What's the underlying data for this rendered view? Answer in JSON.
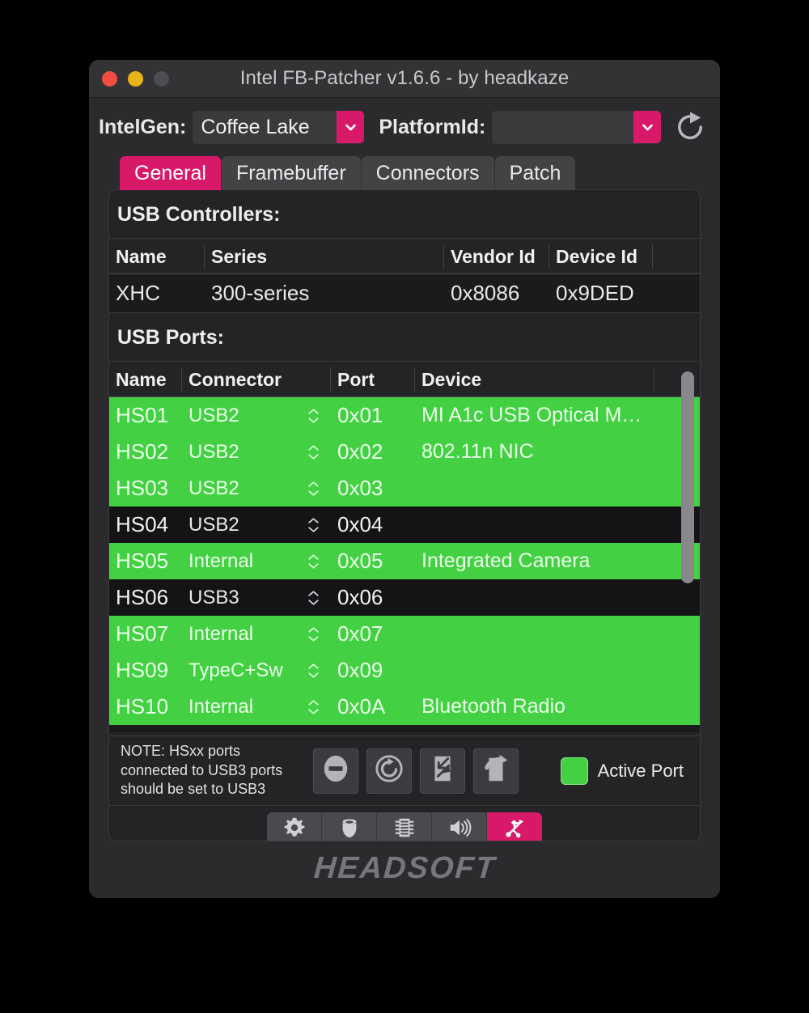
{
  "window": {
    "title": "Intel FB-Patcher v1.6.6 - by headkaze",
    "traffic_lights": [
      "close",
      "minimize",
      "zoom"
    ]
  },
  "toolbar": {
    "intelgen_label": "IntelGen:",
    "intelgen_value": "Coffee Lake",
    "platformid_label": "PlatformId:",
    "platformid_value": "",
    "refresh_icon": "refresh-icon"
  },
  "tabs": [
    {
      "label": "General",
      "active": true
    },
    {
      "label": "Framebuffer",
      "active": false
    },
    {
      "label": "Connectors",
      "active": false
    },
    {
      "label": "Patch",
      "active": false
    }
  ],
  "controllers": {
    "heading": "USB Controllers:",
    "columns": [
      "Name",
      "Series",
      "Vendor Id",
      "Device Id"
    ],
    "rows": [
      {
        "name": "XHC",
        "series": "300-series",
        "vendor_id": "0x8086",
        "device_id": "0x9DED"
      }
    ]
  },
  "ports": {
    "heading": "USB Ports:",
    "columns": [
      "Name",
      "Connector",
      "Port",
      "Device"
    ],
    "rows": [
      {
        "name": "HS01",
        "connector": "USB2",
        "port": "0x01",
        "device": "MI A1c USB Optical M…",
        "active": true
      },
      {
        "name": "HS02",
        "connector": "USB2",
        "port": "0x02",
        "device": "802.11n NIC",
        "active": true
      },
      {
        "name": "HS03",
        "connector": "USB2",
        "port": "0x03",
        "device": "",
        "active": true
      },
      {
        "name": "HS04",
        "connector": "USB2",
        "port": "0x04",
        "device": "",
        "active": false
      },
      {
        "name": "HS05",
        "connector": "Internal",
        "port": "0x05",
        "device": "Integrated Camera",
        "active": true
      },
      {
        "name": "HS06",
        "connector": "USB3",
        "port": "0x06",
        "device": "",
        "active": false
      },
      {
        "name": "HS07",
        "connector": "Internal",
        "port": "0x07",
        "device": "",
        "active": true
      },
      {
        "name": "HS09",
        "connector": "TypeC+Sw",
        "port": "0x09",
        "device": "",
        "active": true
      },
      {
        "name": "HS10",
        "connector": "Internal",
        "port": "0x0A",
        "device": "Bluetooth Radio",
        "active": true
      }
    ]
  },
  "note": "NOTE: HSxx ports connected to USB3 ports should be set to USB3",
  "action_buttons": [
    {
      "name": "disable-port-button",
      "icon": "minus-circle-icon"
    },
    {
      "name": "reset-ports-button",
      "icon": "refresh-circle-icon"
    },
    {
      "name": "import-button",
      "icon": "document-import-icon"
    },
    {
      "name": "export-button",
      "icon": "document-export-icon"
    }
  ],
  "legend": {
    "label": "Active Port",
    "color": "#43D143"
  },
  "bottom_toolbar": [
    {
      "name": "settings-tab",
      "icon": "gear-icon",
      "active": false
    },
    {
      "name": "package-tab",
      "icon": "package-icon",
      "active": false
    },
    {
      "name": "memory-tab",
      "icon": "chip-icon",
      "active": false
    },
    {
      "name": "audio-tab",
      "icon": "speaker-icon",
      "active": false
    },
    {
      "name": "usb-tab",
      "icon": "usb-icon",
      "active": true
    }
  ],
  "footer": {
    "logo": "HEADSOFT"
  },
  "colors": {
    "accent_pink": "#D8196A",
    "active_green": "#43D143",
    "window_bg": "#2B2B2D",
    "panel_bg": "#242426"
  }
}
